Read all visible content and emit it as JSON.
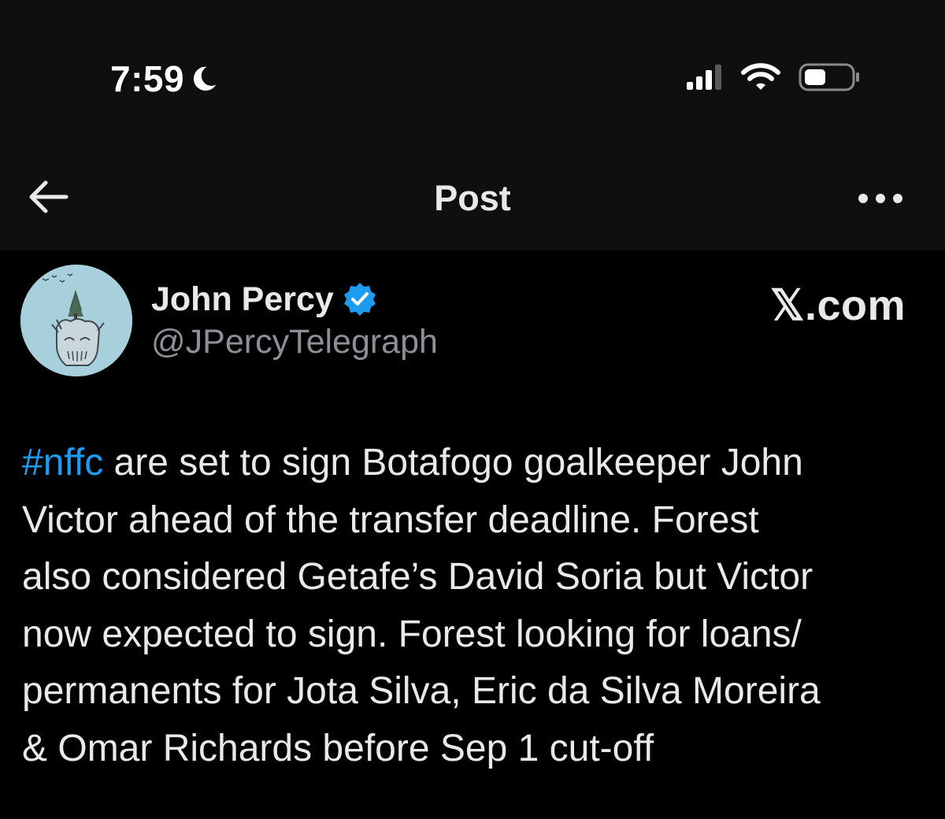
{
  "status_bar": {
    "time": "7:59",
    "focus_icon": "moon-icon",
    "signal_icon": "cellular-signal-icon",
    "wifi_icon": "wifi-icon",
    "battery_icon": "battery-icon"
  },
  "header": {
    "back_icon": "back-arrow-icon",
    "title": "Post",
    "more_icon": "more-options-icon"
  },
  "post": {
    "author": {
      "name": "John Percy",
      "handle": "@JPercyTelegraph",
      "verified_icon": "verified-badge-icon"
    },
    "watermark": "𝕏.com",
    "hashtag": "#nffc",
    "text": " are set to sign Botafogo goalkeeper John\nVictor ahead of the transfer deadline. Forest\nalso considered Getafe’s David Soria but Victor\nnow expected to sign. Forest looking for loans/\npermanents for Jota Silva, Eric da Silva Moreira\n& Omar Richards before Sep 1 cut-off"
  },
  "colors": {
    "background": "#000000",
    "header_background": "#0f0f0f",
    "text": "#e7e9ea",
    "secondary_text": "#8b9097",
    "accent": "#1d9bf0"
  }
}
